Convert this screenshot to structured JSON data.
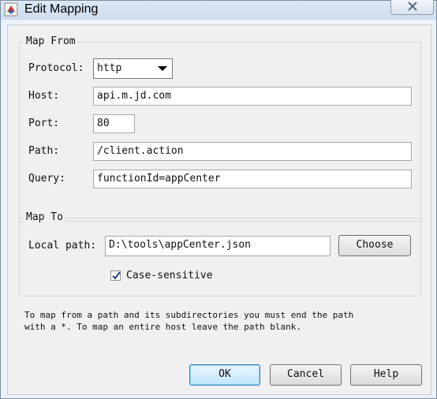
{
  "window": {
    "title": "Edit Mapping"
  },
  "map_from": {
    "legend": "Map From",
    "protocol_label": "Protocol:",
    "protocol_value": "http",
    "host_label": "Host:",
    "host_value": "api.m.jd.com",
    "port_label": "Port:",
    "port_value": "80",
    "path_label": "Path:",
    "path_value": "/client.action",
    "query_label": "Query:",
    "query_value": "functionId=appCenter"
  },
  "map_to": {
    "legend": "Map To",
    "local_path_label": "Local path:",
    "local_path_value": "D:\\tools\\appCenter.json",
    "choose_label": "Choose",
    "case_sensitive_label": "Case-sensitive",
    "case_sensitive_checked": true
  },
  "help": {
    "line1": "To map from a path and its subdirectories you must end the path",
    "line2": "with a *. To map an entire host leave the path blank."
  },
  "buttons": {
    "ok": "OK",
    "cancel": "Cancel",
    "help": "Help"
  }
}
